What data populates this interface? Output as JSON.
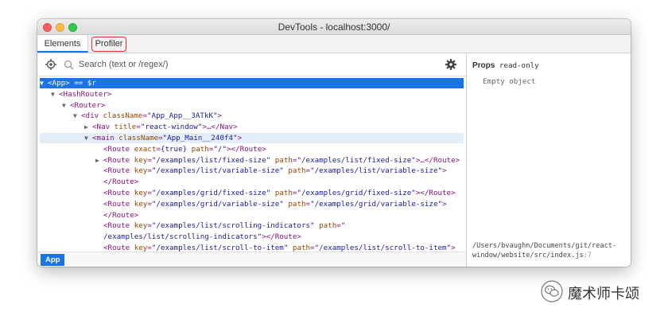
{
  "window": {
    "title": "DevTools - localhost:3000/"
  },
  "tabs": [
    {
      "label": "Elements"
    },
    {
      "label": "Profiler"
    }
  ],
  "search": {
    "placeholder": "Search (text or /regex/)"
  },
  "tree": {
    "rows": [
      {
        "indent": 0,
        "arrow": "▼",
        "selected": true,
        "tag": "<App>",
        "suffix": " == $r"
      },
      {
        "indent": 1,
        "arrow": "▼",
        "tag": "<HashRouter>"
      },
      {
        "indent": 2,
        "arrow": "▼",
        "tag": "<Router>"
      },
      {
        "indent": 3,
        "arrow": "▼",
        "tag": "<div ",
        "attrs": [
          {
            "name": "className",
            "value": "\"App_App__3ATkK\""
          }
        ],
        "close": ">"
      },
      {
        "indent": 4,
        "arrow": "▶",
        "tag": "<Nav ",
        "attrs": [
          {
            "name": "title",
            "value": "\"react-window\""
          }
        ],
        "close": ">…</Nav>"
      },
      {
        "indent": 4,
        "arrow": "▼",
        "hovered": true,
        "tag": "<main ",
        "attrs": [
          {
            "name": "className",
            "value": "\"App_Main__240f4\""
          }
        ],
        "close": ">"
      },
      {
        "indent": 5,
        "arrow": "",
        "tag": "<Route ",
        "attrs": [
          {
            "name": "exact",
            "value": "{true} "
          },
          {
            "name": "path",
            "value": "\"/\""
          }
        ],
        "close": "></Route>"
      },
      {
        "indent": 5,
        "arrow": "▶",
        "tag": "<Route ",
        "attrs": [
          {
            "name": "key",
            "value": "\"/examples/list/fixed-size\" "
          },
          {
            "name": "path",
            "value": "\"/examples/list/fixed-size\""
          }
        ],
        "close": ">…</Route>"
      },
      {
        "indent": 5,
        "arrow": "",
        "tag": "<Route ",
        "attrs": [
          {
            "name": "key",
            "value": "\"/examples/list/variable-size\" "
          },
          {
            "name": "path",
            "value": "\"/examples/list/variable-size\""
          }
        ],
        "close": ">"
      },
      {
        "indent": 5,
        "arrow": "",
        "tag": "</Route>"
      },
      {
        "indent": 5,
        "arrow": "",
        "tag": "<Route ",
        "attrs": [
          {
            "name": "key",
            "value": "\"/examples/grid/fixed-size\" "
          },
          {
            "name": "path",
            "value": "\"/examples/grid/fixed-size\""
          }
        ],
        "close": "></Route>"
      },
      {
        "indent": 5,
        "arrow": "",
        "tag": "<Route ",
        "attrs": [
          {
            "name": "key",
            "value": "\"/examples/grid/variable-size\" "
          },
          {
            "name": "path",
            "value": "\"/examples/grid/variable-size\""
          }
        ],
        "close": ">"
      },
      {
        "indent": 5,
        "arrow": "",
        "tag": "</Route>"
      },
      {
        "indent": 5,
        "arrow": "",
        "tag": "<Route ",
        "attrs": [
          {
            "name": "key",
            "value": "\"/examples/list/scrolling-indicators\" "
          },
          {
            "name": "path",
            "value": "\""
          }
        ]
      },
      {
        "indent": 5,
        "arrow": "",
        "tag": "",
        "attrs": [
          {
            "name": "",
            "value": "/examples/list/scrolling-indicators\""
          }
        ],
        "close": "></Route>"
      },
      {
        "indent": 5,
        "arrow": "",
        "tag": "<Route ",
        "attrs": [
          {
            "name": "key",
            "value": "\"/examples/list/scroll-to-item\" "
          },
          {
            "name": "path",
            "value": "\"/examples/list/scroll-to-item\""
          }
        ],
        "close": ">"
      }
    ]
  },
  "status": {
    "breadcrumb": "App"
  },
  "props": {
    "label": "Props",
    "readonly": "read-only",
    "empty": "Empty object",
    "source_path": "/Users/bvaughn/Documents/git/react-window/website/src/index.js",
    "source_line": ":7"
  },
  "watermark": {
    "text": "魔术师卡颂"
  },
  "colors": {
    "selection": "#1a73e8",
    "tag": "#881280",
    "attr_name": "#994500",
    "attr_value": "#1a1aa6",
    "highlight": "#e0302a"
  }
}
